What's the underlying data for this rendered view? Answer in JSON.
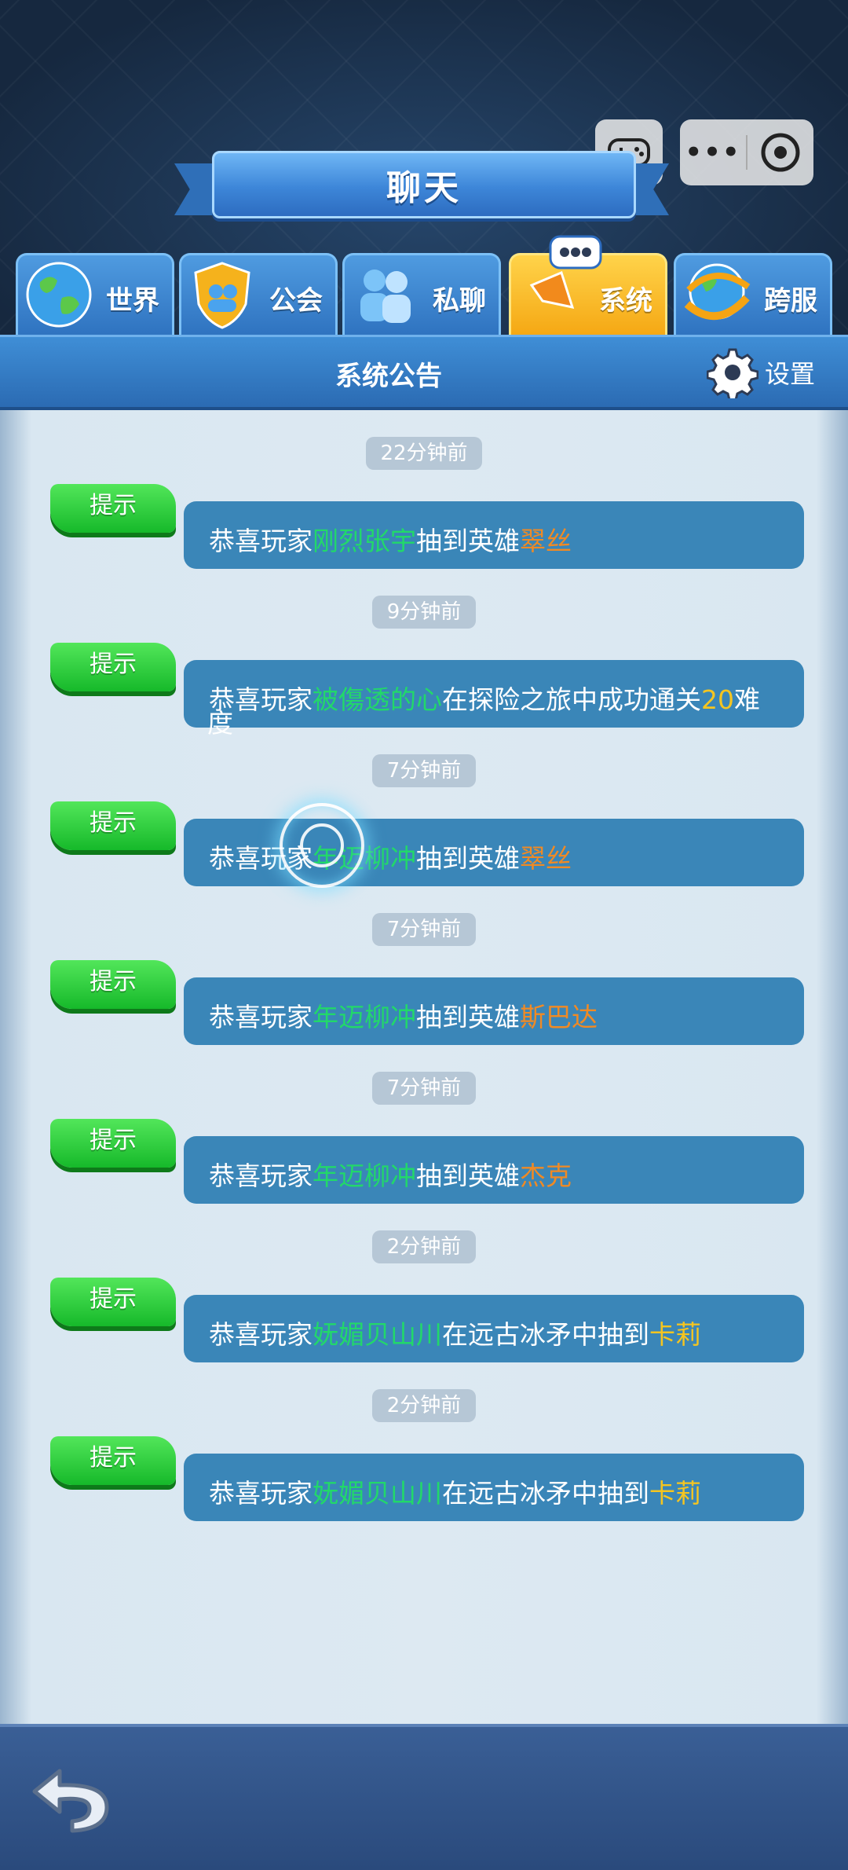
{
  "header": {
    "title": "聊天"
  },
  "capsule": {
    "game_icon": "gamepad-icon",
    "more_icon": "more-dots-icon",
    "close_icon": "target-close-icon"
  },
  "tabs": [
    {
      "label": "世界",
      "icon": "globe-icon"
    },
    {
      "label": "公会",
      "icon": "guild-shield-icon"
    },
    {
      "label": "私聊",
      "icon": "private-chat-icon"
    },
    {
      "label": "系统",
      "icon": "megaphone-icon",
      "active": true
    },
    {
      "label": "跨服",
      "icon": "cross-server-icon"
    }
  ],
  "section": {
    "title": "系统公告",
    "settings_label": "设置"
  },
  "messages": [
    {
      "time": "22分钟前",
      "tag": "提示",
      "prefix": "恭喜玩家",
      "player": "刚烈张宇",
      "mid": "抽到英雄",
      "item": "翠丝",
      "item_color": "orange"
    },
    {
      "time": "9分钟前",
      "tag": "提示",
      "prefix": "恭喜玩家",
      "player": "被傷透的心",
      "mid": "在探险之旅中成功通关",
      "item": "20",
      "tail1": "难",
      "tail2": "度",
      "item_color": "yellow"
    },
    {
      "time": "7分钟前",
      "tag": "提示",
      "prefix": "恭喜玩家",
      "player": "年迈柳冲",
      "mid": "抽到英雄",
      "item": "翠丝",
      "item_color": "orange"
    },
    {
      "time": "7分钟前",
      "tag": "提示",
      "prefix": "恭喜玩家",
      "player": "年迈柳冲",
      "mid": "抽到英雄",
      "item": "斯巴达",
      "item_color": "orange"
    },
    {
      "time": "7分钟前",
      "tag": "提示",
      "prefix": "恭喜玩家",
      "player": "年迈柳冲",
      "mid": "抽到英雄",
      "item": "杰克",
      "item_color": "orange"
    },
    {
      "time": "2分钟前",
      "tag": "提示",
      "prefix": "恭喜玩家",
      "player": "妩媚贝山川",
      "mid": "在远古冰矛中抽到",
      "item": "卡莉",
      "item_color": "yellow"
    },
    {
      "time": "2分钟前",
      "tag": "提示",
      "prefix": "恭喜玩家",
      "player": "妩媚贝山川",
      "mid": "在远古冰矛中抽到",
      "item": "卡莉",
      "item_color": "yellow"
    }
  ],
  "footer": {
    "back_icon": "back-arrow-icon"
  }
}
